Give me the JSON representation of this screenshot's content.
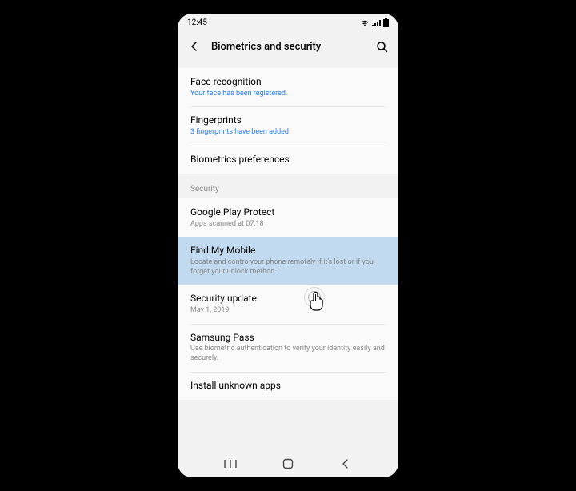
{
  "status": {
    "time": "12:45"
  },
  "header": {
    "title": "Biometrics and security"
  },
  "rows": {
    "face": {
      "label": "Face recognition",
      "sub": "Your face has been registered."
    },
    "fingerprints": {
      "label": "Fingerprints",
      "sub": "3 fingerprints have been added"
    },
    "bioprefs": {
      "label": "Biometrics preferences"
    },
    "section_security": "Security",
    "playprotect": {
      "label": "Google Play Protect",
      "sub": "Apps scanned at 07:18"
    },
    "findmymobile": {
      "label": "Find My Mobile",
      "sub": "Locate and contro your phone remotely if it's lost or if you forget your unlock method."
    },
    "securityupdate": {
      "label": "Security update",
      "sub": "May 1, 2019"
    },
    "samsungpass": {
      "label": "Samsung Pass",
      "sub": "Use biometric authentication to verify your identity easily and securely."
    },
    "installunknown": {
      "label": "Install unknown apps"
    }
  }
}
